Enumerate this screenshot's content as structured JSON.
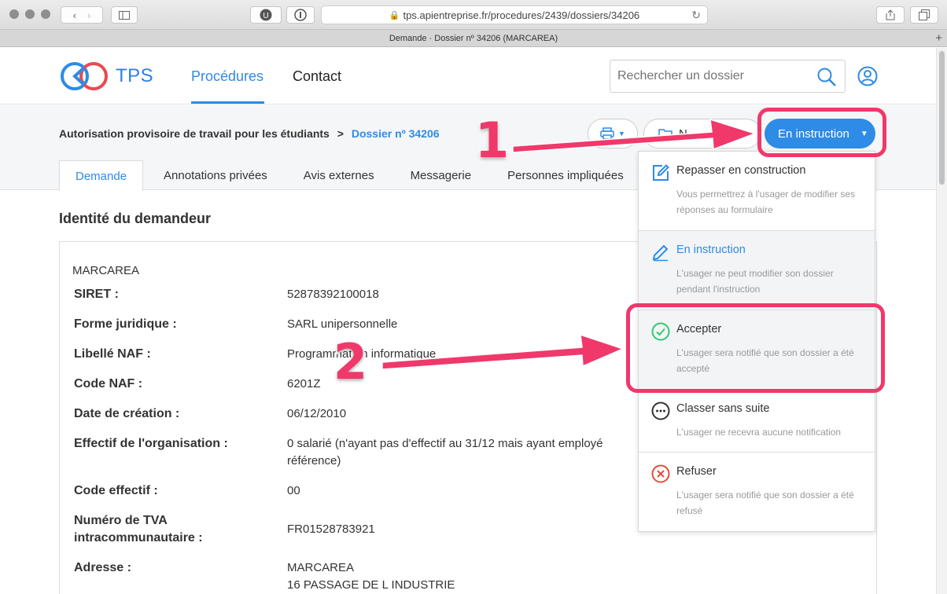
{
  "browser": {
    "url": "tps.apientreprise.fr/procedures/2439/dossiers/34206",
    "tab_title": "Demande · Dossier nº 34206 (MARCAREA)"
  },
  "header": {
    "logo_text": "TPS",
    "nav": {
      "procedures": "Procédures",
      "contact": "Contact"
    },
    "search_placeholder": "Rechercher un dossier"
  },
  "toolbar": {
    "breadcrumb_procedure": "Autorisation provisoire de travail pour les étudiants",
    "breadcrumb_sep": ">",
    "breadcrumb_dossier": "Dossier nº 34206",
    "note_btn_partial": "N",
    "status_label": "En instruction"
  },
  "tabs": [
    "Demande",
    "Annotations privées",
    "Avis externes",
    "Messagerie",
    "Personnes impliquées"
  ],
  "main": {
    "section_title": "Identité du demandeur",
    "company": "MARCAREA",
    "rows": [
      {
        "label": "SIRET :",
        "value": "52878392100018"
      },
      {
        "label": "Forme juridique :",
        "value": "SARL unipersonnelle"
      },
      {
        "label": "Libellé NAF :",
        "value": "Programmation informatique"
      },
      {
        "label": "Code NAF :",
        "value": "6201Z"
      },
      {
        "label": "Date de création :",
        "value": "06/12/2010"
      },
      {
        "label": "Effectif de l'organisation :",
        "value": "0 salarié (n'ayant pas d'effectif au 31/12 mais ayant employé",
        "value2": "référence)"
      },
      {
        "label": "Code effectif :",
        "value": "00"
      },
      {
        "label": "Numéro de TVA",
        "label2": "intracommunautaire :",
        "value": "FR01528783921"
      },
      {
        "label": "Adresse :",
        "value": "MARCAREA",
        "value2": "16 PASSAGE DE L INDUSTRIE"
      }
    ]
  },
  "dropdown": {
    "items": [
      {
        "title": "Repasser en construction",
        "desc": "Vous permettrez à l'usager de modifier ses réponses au formulaire",
        "icon": "edit-icon"
      },
      {
        "title": "En instruction",
        "desc": "L'usager ne peut modifier son dossier pendant l'instruction",
        "icon": "pencil-icon"
      },
      {
        "title": "Accepter",
        "desc": "L'usager sera notifié que son dossier a été accepté",
        "icon": "check-circle-icon"
      },
      {
        "title": "Classer sans suite",
        "desc": "L'usager ne recevra aucune notification",
        "icon": "dots-circle-icon"
      },
      {
        "title": "Refuser",
        "desc": "L'usager sera notifié que son dossier a été refusé",
        "icon": "x-circle-icon"
      }
    ]
  },
  "annotations": {
    "step1": "1",
    "step2": "2"
  },
  "colors": {
    "accent": "#2e8be6",
    "annotation": "#f0386b",
    "success": "#2ecc71",
    "danger": "#e74c3c"
  }
}
